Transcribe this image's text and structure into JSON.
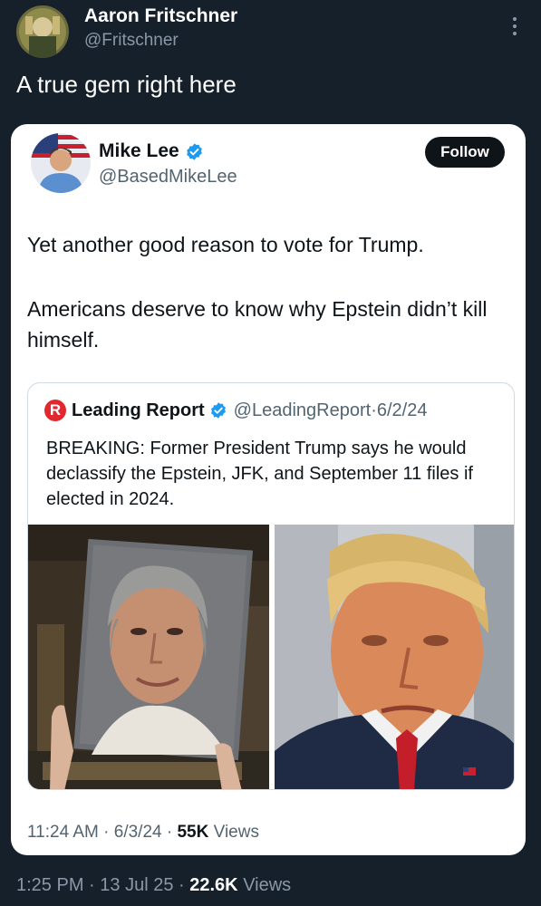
{
  "outer_tweet": {
    "author_name": "Aaron Fritschner",
    "author_handle": "@Fritschner",
    "text": "A true gem right here",
    "time": "1:25 PM",
    "date": "13 Jul 25",
    "views_count": "22.6K",
    "views_label": "Views"
  },
  "quoted_tweet": {
    "author_name": "Mike Lee",
    "author_handle": "@BasedMikeLee",
    "follow_label": "Follow",
    "text_line1": "Yet another good reason to vote for Trump.",
    "text_line2": "Americans deserve to know why Epstein didn’t kill himself.",
    "time": "11:24 AM",
    "date": "6/3/24",
    "views_count": "55K",
    "views_label": "Views"
  },
  "nested_quote": {
    "logo_letter": "R",
    "author_name": "Leading Report",
    "author_handle": "@LeadingReport",
    "date": "6/2/24",
    "text": "BREAKING: Former President Trump says he would declassify the Epstein, JFK, and September 11 files if elected in 2024."
  },
  "separator": "·",
  "icons": {
    "more": "more-vertical-icon",
    "verified": "verified-badge-icon",
    "logo": "leading-report-logo"
  },
  "colors": {
    "background": "#15202b",
    "card": "#ffffff",
    "verified": "#1d9bf0",
    "logo_red": "#e0282e",
    "follow_button": "#0f1419"
  }
}
